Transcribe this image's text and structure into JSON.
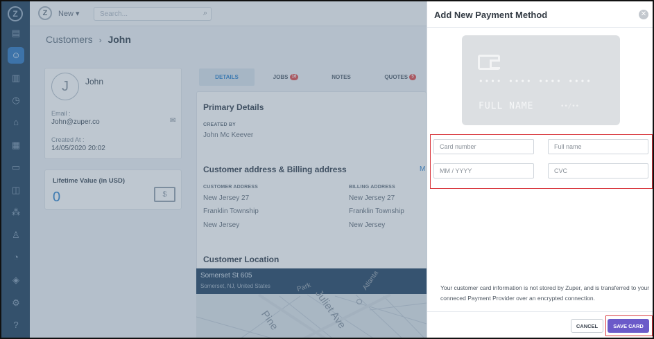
{
  "app": {
    "new_label": "New ▾",
    "search_placeholder": "Search..."
  },
  "breadcrumb": {
    "parent": "Customers",
    "separator": "›",
    "current": "John"
  },
  "customer": {
    "avatar_initial": "J",
    "name": "John",
    "email_label": "Email :",
    "email": "John@zuper.co",
    "created_label": "Created At :",
    "created": "14/05/2020 20:02",
    "lifetime_label": "Lifetime Value (in USD)",
    "lifetime_value": "0"
  },
  "tabs": [
    {
      "label": "DETAILS"
    },
    {
      "label": "JOBS",
      "badge": "16"
    },
    {
      "label": "NOTES"
    },
    {
      "label": "QUOTES",
      "badge": "5"
    }
  ],
  "primary": {
    "title": "Primary Details",
    "created_by_label": "CREATED BY",
    "created_by": "John Mc Keever"
  },
  "address": {
    "title": "Customer address & Billing address",
    "cut_label": "M",
    "customer_label": "CUSTOMER ADDRESS",
    "billing_label": "BILLING ADDRESS",
    "customer_lines": [
      "New Jersey 27",
      "Franklin Township",
      "New Jersey"
    ],
    "billing_lines": [
      "New Jersey 27",
      "Franklin Township",
      "New Jersey"
    ]
  },
  "location": {
    "title": "Customer Location",
    "map_title": "Somerset St 605",
    "map_sub": "Somerset, NJ, United States",
    "streets": [
      "Pine",
      "Juliet Ave",
      "Park",
      "Atlanta"
    ]
  },
  "modal": {
    "title": "Add New Payment Method",
    "card_number_mask": "•••• •••• •••• ••••",
    "card_name_mask": "FULL NAME",
    "card_exp_mask": "••/••",
    "card_number_placeholder": "Card number",
    "full_name_placeholder": "Full name",
    "expiry_placeholder": "MM / YYYY",
    "cvc_placeholder": "CVC",
    "notice": "Your customer card information is not stored by Zuper, and is transferred to your conneced Payment Provider over an encrypted connection.",
    "cancel_label": "CANCEL",
    "save_label": "SAVE CARD"
  },
  "colors": {
    "rail": "#2c4a66",
    "accent": "#3b8ad0",
    "save_button": "#6b5ac9",
    "highlight": "#d9373d"
  }
}
